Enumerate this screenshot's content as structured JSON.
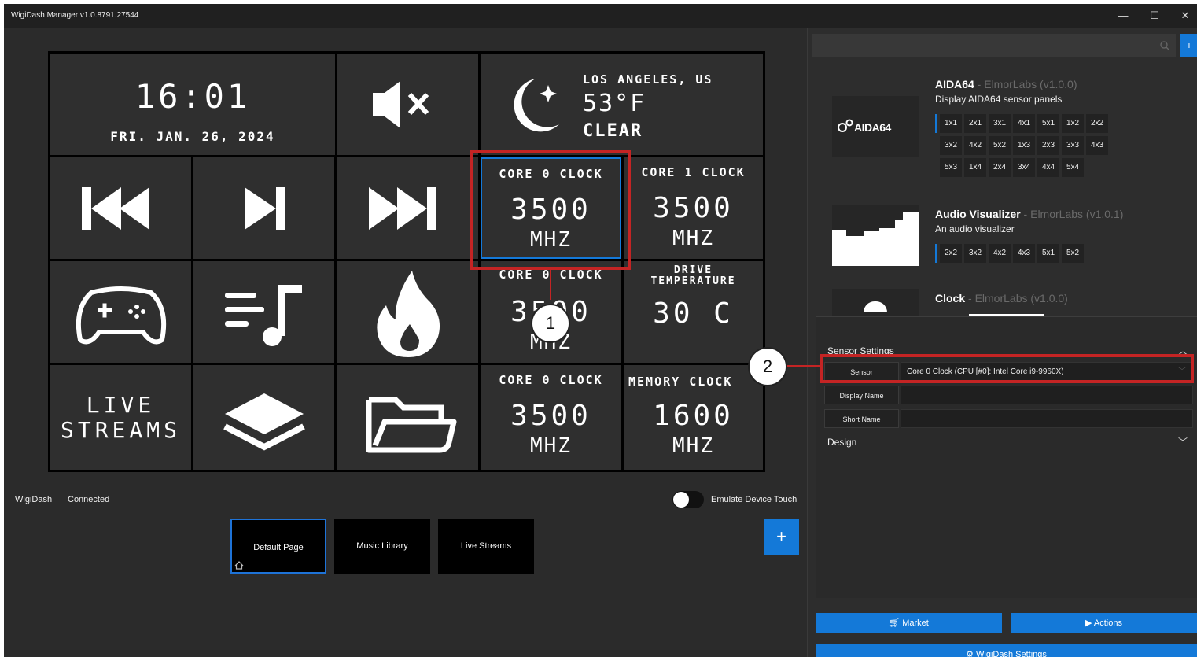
{
  "window": {
    "title": "WigiDash Manager v1.0.8791.27544",
    "minimize": "—",
    "maximize": "☐",
    "close": "✕"
  },
  "tiles": {
    "clock": {
      "time": "16:01",
      "date": "FRI. JAN. 26, 2024"
    },
    "weather": {
      "city": "LOS ANGELES, US",
      "temp": "53°F",
      "condition": "CLEAR"
    },
    "core0": {
      "label": "CORE 0 CLOCK",
      "value": "3500",
      "unit": "MHZ"
    },
    "core1": {
      "label": "CORE 1 CLOCK",
      "value": "3500",
      "unit": "MHZ"
    },
    "core0b": {
      "label": "CORE 0 CLOCK",
      "value": "3500",
      "unit": "MHZ"
    },
    "drive": {
      "label1": "DRIVE",
      "label2": "TEMPERATURE",
      "value": "30 C"
    },
    "core0c": {
      "label": "CORE 0 CLOCK",
      "value": "3500",
      "unit": "MHZ"
    },
    "memory": {
      "label": "MEMORY CLOCK",
      "value": "1600",
      "unit": "MHZ"
    },
    "live": {
      "line1": "LIVE",
      "line2": "STREAMS"
    }
  },
  "callouts": {
    "one": "1",
    "two": "2"
  },
  "status": {
    "device": "WigiDash",
    "state": "Connected",
    "emulate_label": "Emulate Device Touch"
  },
  "pages": [
    "Default Page",
    "Music Library",
    "Live Streams"
  ],
  "add_page": "+",
  "widgets": {
    "aida64": {
      "name": "AIDA64",
      "author": " - ElmorLabs (v1.0.0)",
      "desc": "Display AIDA64 sensor panels",
      "logo": "AIDA64",
      "sizes": [
        "1x1",
        "2x1",
        "3x1",
        "4x1",
        "5x1",
        "1x2",
        "2x2",
        "3x2",
        "4x2",
        "5x2",
        "1x3",
        "2x3",
        "3x3",
        "4x3",
        "5x3",
        "1x4",
        "2x4",
        "3x4",
        "4x4",
        "5x4"
      ]
    },
    "audio": {
      "name": "Audio Visualizer",
      "author": " - ElmorLabs (v1.0.1)",
      "desc": "An audio visualizer",
      "sizes": [
        "2x2",
        "3x2",
        "4x2",
        "4x3",
        "5x1",
        "5x2"
      ]
    },
    "clock": {
      "name": "Clock",
      "author": " - ElmorLabs (v1.0.0)"
    }
  },
  "sensor_settings": {
    "header": "Sensor Settings",
    "sensor_label": "Sensor",
    "sensor_value": "Core 0 Clock  (CPU [#0]: Intel Core i9-9960X)",
    "display_name_label": "Display Name",
    "display_name_value": "",
    "short_name_label": "Short Name",
    "short_name_value": "",
    "design_header": "Design"
  },
  "buttons": {
    "market": "Market",
    "actions": "▶ Actions",
    "settings": "WigiDash Settings"
  },
  "colors": {
    "accent": "#1479d8",
    "highlight": "#c42424"
  }
}
